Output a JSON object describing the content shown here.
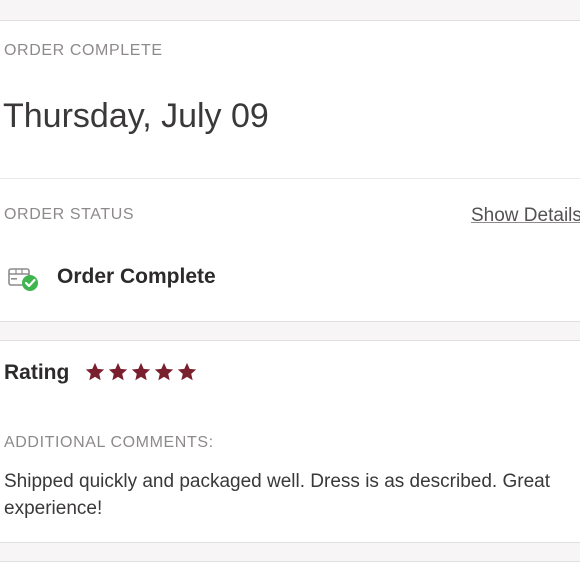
{
  "order": {
    "section_label": "ORDER COMPLETE",
    "date": "Thursday, July 09",
    "status_label": "ORDER STATUS",
    "show_details": "Show Details",
    "status_icon": "package-check-icon",
    "status_text": "Order Complete"
  },
  "rating": {
    "label": "Rating",
    "stars": 5,
    "max_stars": 5,
    "star_color": "#7a1f2e",
    "comments_label": "ADDITIONAL COMMENTS:",
    "comments": "Shipped quickly and packaged well. Dress is as described. Great experience!"
  },
  "colors": {
    "background": "#f7f5f6",
    "card": "#ffffff",
    "check_badge": "#3fb54f"
  }
}
